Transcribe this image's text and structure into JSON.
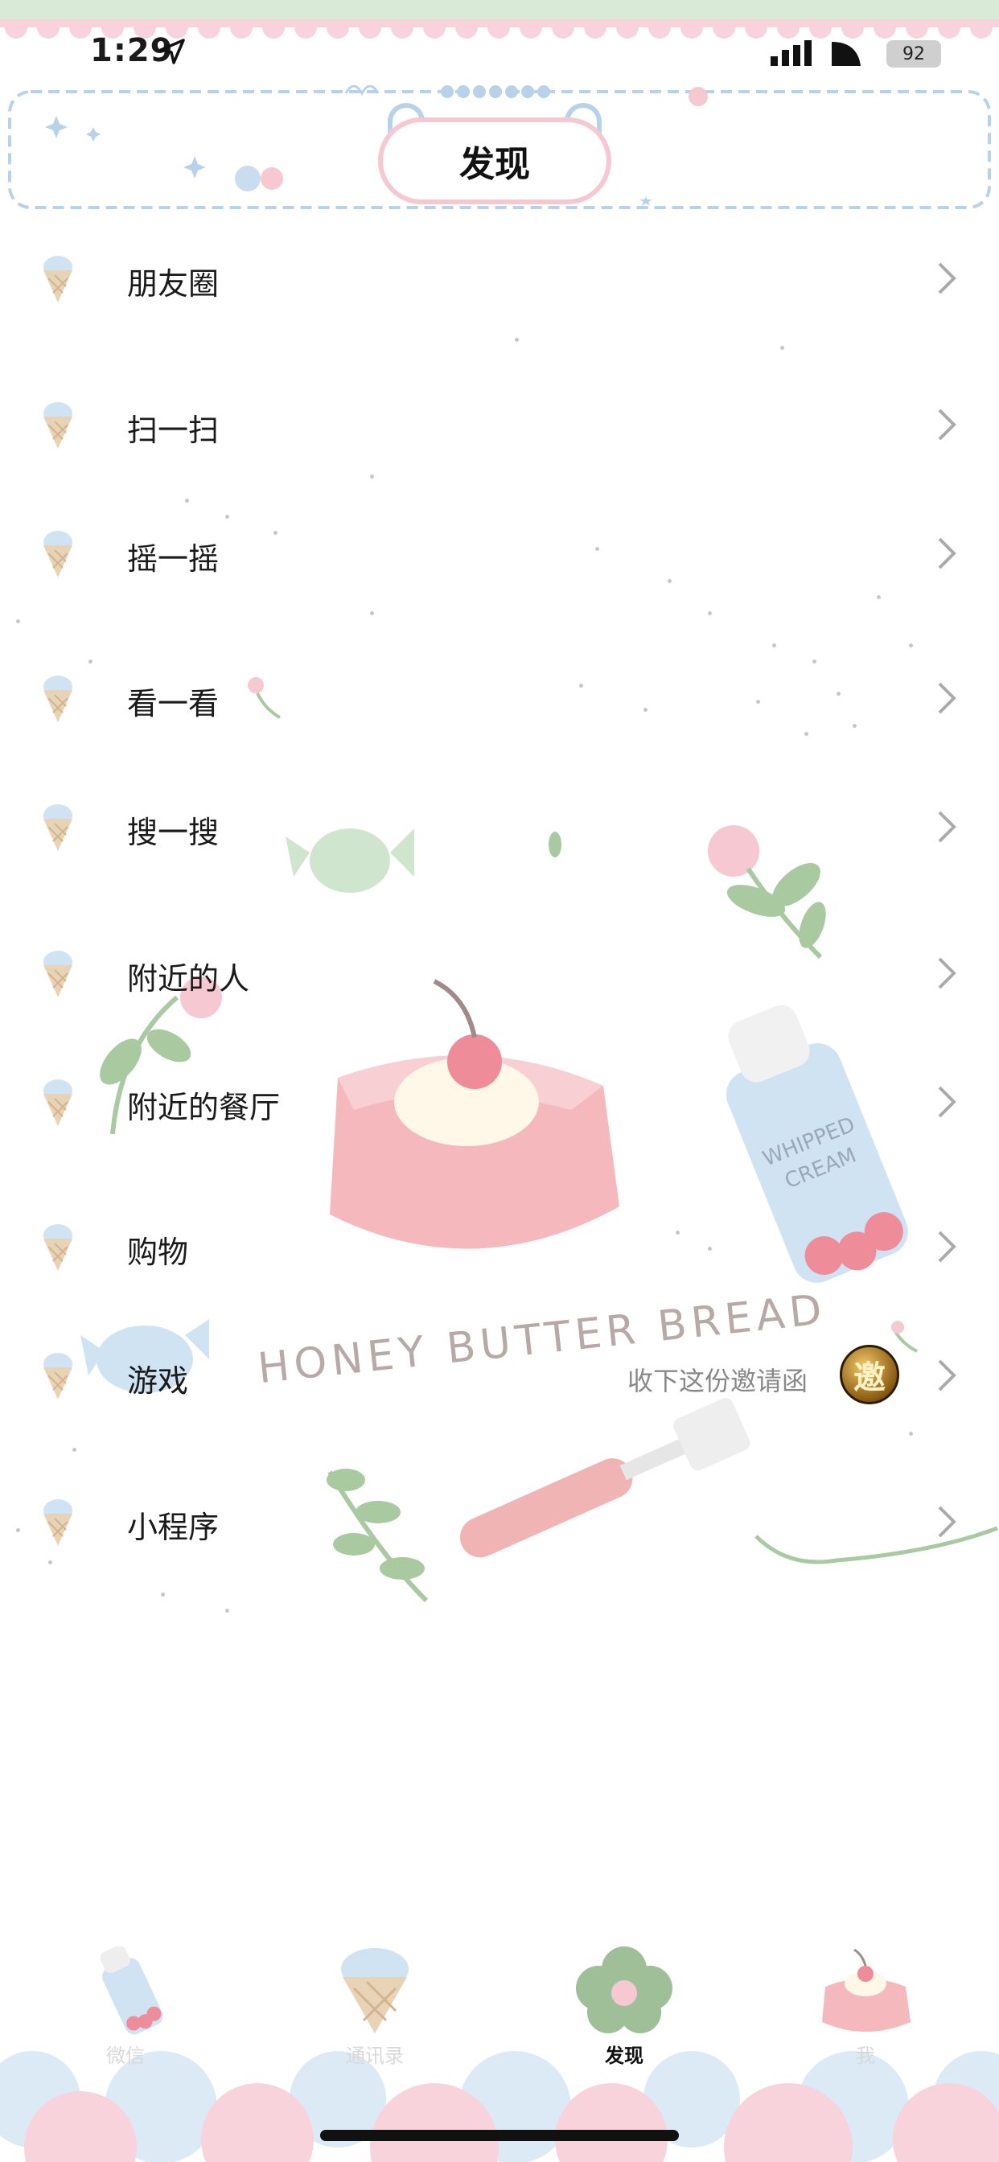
{
  "status_bar": {
    "time": "1:29",
    "battery": "92",
    "icons": [
      "location-arrow-icon",
      "cellular-signal-icon",
      "wifi-icon",
      "battery-icon"
    ]
  },
  "header": {
    "title": "发现"
  },
  "menu": {
    "items": [
      {
        "label": "朋友圈"
      },
      {
        "label": "扫一扫"
      },
      {
        "label": "摇一摇"
      },
      {
        "label": "看一看"
      },
      {
        "label": "搜一搜"
      },
      {
        "label": "附近的人"
      },
      {
        "label": "附近的餐厅"
      },
      {
        "label": "购物"
      },
      {
        "label": "游戏",
        "promo": "收下这份邀请函",
        "badge": "邀"
      },
      {
        "label": "小程序"
      }
    ]
  },
  "decor_text": {
    "bread": "HONEY BUTTER BREAD",
    "cream_1": "WHIPPED",
    "cream_2": "CREAM"
  },
  "tabbar": {
    "tabs": [
      {
        "label": "微信",
        "icon": "whipped-cream-bottle-icon"
      },
      {
        "label": "通讯录",
        "icon": "ice-cream-cone-icon"
      },
      {
        "label": "发现",
        "icon": "flower-icon",
        "active": true
      },
      {
        "label": "我",
        "icon": "cake-icon"
      }
    ]
  },
  "colors": {
    "accent_pink": "#f6c8d2",
    "accent_blue": "#b8d2ea",
    "accent_green": "#a9c9a0",
    "text": "#1a1a1a",
    "muted_text": "#888888",
    "tab_inactive": "#d9d9d9"
  }
}
